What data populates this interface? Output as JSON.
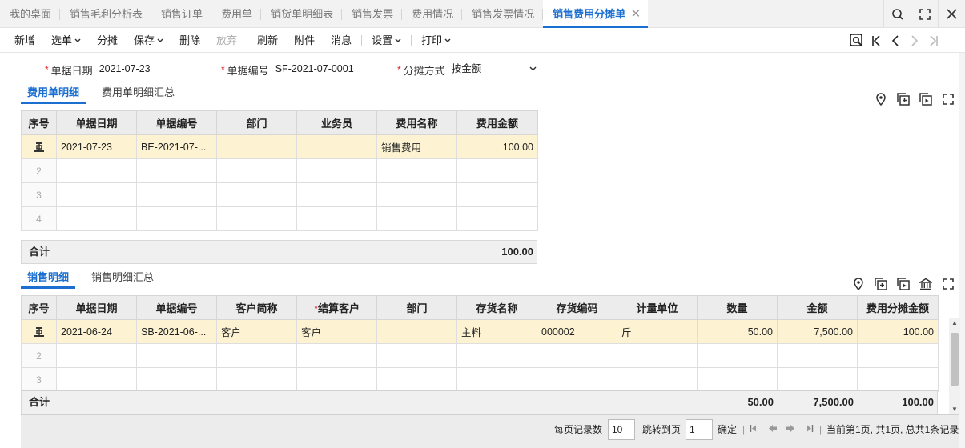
{
  "tabs": [
    {
      "label": "我的桌面"
    },
    {
      "label": "销售毛利分析表"
    },
    {
      "label": "销售订单"
    },
    {
      "label": "费用单"
    },
    {
      "label": "销货单明细表"
    },
    {
      "label": "销售发票"
    },
    {
      "label": "费用情况"
    },
    {
      "label": "销售发票情况"
    },
    {
      "label": "销售费用分摊单",
      "active": true
    }
  ],
  "toolbar": {
    "new": "新增",
    "select": "选单",
    "allocate": "分摊",
    "save": "保存",
    "delete": "删除",
    "discard": "放弃",
    "refresh": "刷新",
    "attach": "附件",
    "message": "消息",
    "settings": "设置",
    "print": "打印"
  },
  "form": {
    "date_label": "单据日期",
    "date_value": "2021-07-23",
    "code_label": "单据编号",
    "code_value": "SF-2021-07-0001",
    "method_label": "分摊方式",
    "method_value": "按金额",
    "required_mark": "*"
  },
  "expense": {
    "tabs": [
      "费用单明细",
      "费用单明细汇总"
    ],
    "headers": [
      "序号",
      "单据日期",
      "单据编号",
      "部门",
      "业务员",
      "费用名称",
      "费用金额"
    ],
    "rows": [
      [
        "",
        "2021-07-23",
        "BE-2021-07-...",
        "",
        "",
        "销售费用",
        "100.00"
      ],
      [
        "2",
        "",
        "",
        "",
        "",
        "",
        ""
      ],
      [
        "3",
        "",
        "",
        "",
        "",
        "",
        ""
      ],
      [
        "4",
        "",
        "",
        "",
        "",
        "",
        ""
      ]
    ],
    "total_label": "合计",
    "total_value": "100.00"
  },
  "sales": {
    "tabs": [
      "销售明细",
      "销售明细汇总"
    ],
    "headers": [
      "序号",
      "单据日期",
      "单据编号",
      "客户简称",
      "结算客户",
      "部门",
      "存货名称",
      "存货编码",
      "计量单位",
      "数量",
      "金额",
      "费用分摊金额"
    ],
    "required_header_mark": "*",
    "rows": [
      [
        "",
        "2021-06-24",
        "SB-2021-06-...",
        "客户",
        "客户",
        "",
        "主料",
        "000002",
        "斤",
        "50.00",
        "7,500.00",
        "100.00"
      ],
      [
        "2",
        "",
        "",
        "",
        "",
        "",
        "",
        "",
        "",
        "",
        "",
        ""
      ],
      [
        "3",
        "",
        "",
        "",
        "",
        "",
        "",
        "",
        "",
        "",
        "",
        ""
      ]
    ],
    "total_label": "合计",
    "total_qty": "50.00",
    "total_amount": "7,500.00",
    "total_alloc": "100.00"
  },
  "pager": {
    "per_page_label": "每页记录数",
    "per_page": "10",
    "jump_label": "跳转到页",
    "jump_page": "1",
    "confirm": "确定",
    "status": "当前第1页, 共1页, 总共1条记录"
  }
}
